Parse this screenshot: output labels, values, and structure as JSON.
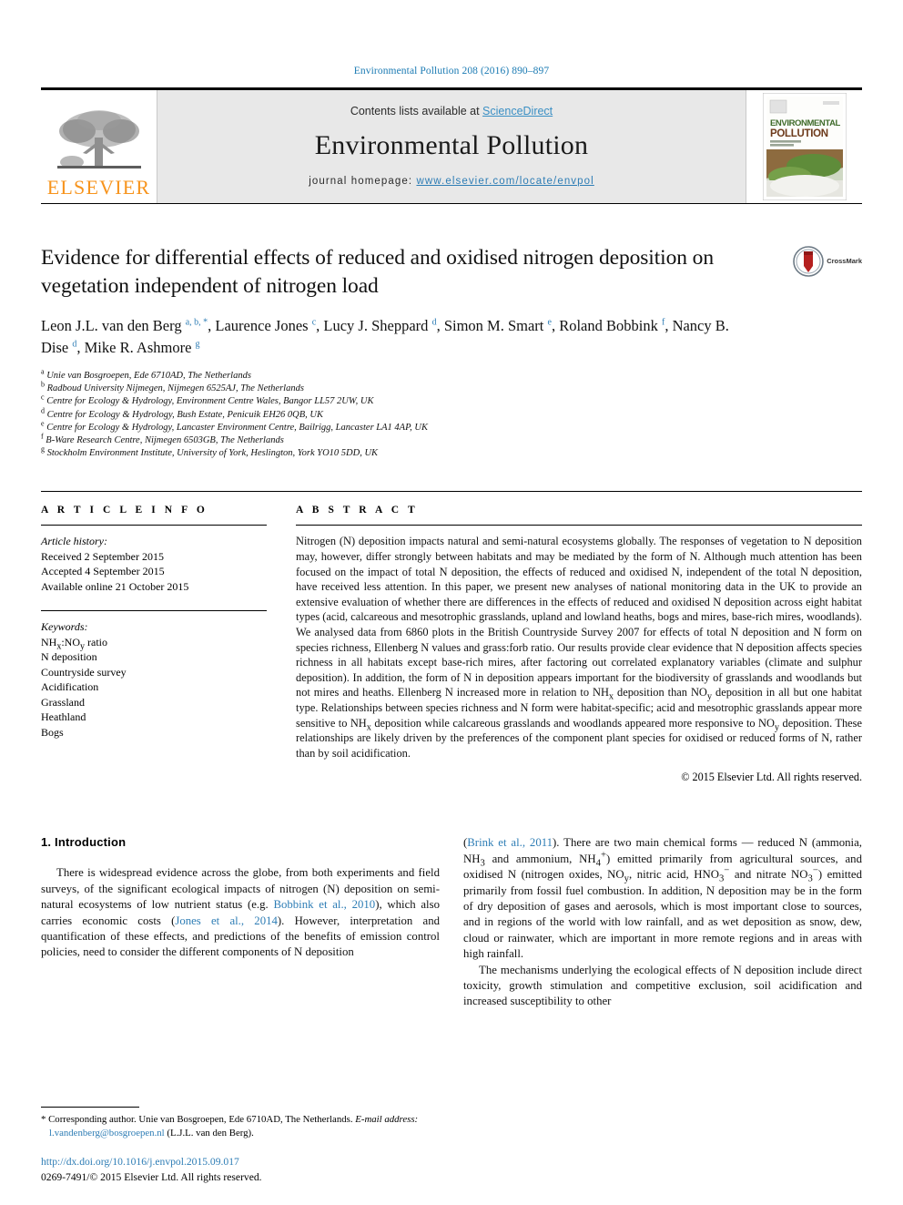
{
  "running_head": "Environmental Pollution 208 (2016) 890–897",
  "masthead": {
    "contents_prefix": "Contents lists available at ",
    "sciencedirect": "ScienceDirect",
    "journal_title": "Environmental Pollution",
    "homepage_label": "journal homepage:",
    "homepage_url": "www.elsevier.com/locate/envpol",
    "publisher": "ELSEVIER",
    "cover_line1": "ENVIRONMENTAL",
    "cover_line2": "POLLUTION"
  },
  "crossmark": {
    "label": "CrossMark"
  },
  "article": {
    "title": "Evidence for differential effects of reduced and oxidised nitrogen deposition on vegetation independent of nitrogen load",
    "authors_html": "Leon J.L. van den Berg <sup>a, b, *</sup>, Laurence Jones <sup>c</sup>, Lucy J. Sheppard <sup>d</sup>, Simon M. Smart <sup>e</sup>, Roland Bobbink <sup>f</sup>, Nancy B. Dise <sup>d</sup>, Mike R. Ashmore <sup>g</sup>",
    "affiliations": [
      {
        "mark": "a",
        "text": "Unie van Bosgroepen, Ede 6710AD, The Netherlands"
      },
      {
        "mark": "b",
        "text": "Radboud University Nijmegen, Nijmegen 6525AJ, The Netherlands"
      },
      {
        "mark": "c",
        "text": "Centre for Ecology & Hydrology, Environment Centre Wales, Bangor LL57 2UW, UK"
      },
      {
        "mark": "d",
        "text": "Centre for Ecology & Hydrology, Bush Estate, Penicuik EH26 0QB, UK"
      },
      {
        "mark": "e",
        "text": "Centre for Ecology & Hydrology, Lancaster Environment Centre, Bailrigg, Lancaster LA1 4AP, UK"
      },
      {
        "mark": "f",
        "text": "B-Ware Research Centre, Nijmegen 6503GB, The Netherlands"
      },
      {
        "mark": "g",
        "text": "Stockholm Environment Institute, University of York, Heslington, York YO10 5DD, UK"
      }
    ]
  },
  "article_info": {
    "heading": "A R T I C L E  I N F O",
    "history_label": "Article history:",
    "history": [
      "Received 2 September 2015",
      "Accepted 4 September 2015",
      "Available online 21 October 2015"
    ],
    "keywords_label": "Keywords:",
    "keywords_html": [
      "NH<sub>x</sub>:NO<sub>y</sub> ratio",
      "N deposition",
      "Countryside survey",
      "Acidification",
      "Grassland",
      "Heathland",
      "Bogs"
    ]
  },
  "abstract": {
    "heading": "A B S T R A C T",
    "text_html": "Nitrogen (N) deposition impacts natural and semi-natural ecosystems globally. The responses of vegetation to N deposition may, however, differ strongly between habitats and may be mediated by the form of N. Although much attention has been focused on the impact of total N deposition, the effects of reduced and oxidised N, independent of the total N deposition, have received less attention. In this paper, we present new analyses of national monitoring data in the UK to provide an extensive evaluation of whether there are differences in the effects of reduced and oxidised N deposition across eight habitat types (acid, calcareous and mesotrophic grasslands, upland and lowland heaths, bogs and mires, base-rich mires, woodlands). We analysed data from 6860 plots in the British Countryside Survey 2007 for effects of total N deposition and N form on species richness, Ellenberg N values and grass:forb ratio. Our results provide clear evidence that N deposition affects species richness in all habitats except base-rich mires, after factoring out correlated explanatory variables (climate and sulphur deposition). In addition, the form of N in deposition appears important for the biodiversity of grasslands and woodlands but not mires and heaths. Ellenberg N increased more in relation to NH<sub>x</sub> deposition than NO<sub>y</sub> deposition in all but one habitat type. Relationships between species richness and N form were habitat-specific; acid and mesotrophic grasslands appear more sensitive to NH<sub>x</sub> deposition while calcareous grasslands and woodlands appeared more responsive to NO<sub>y</sub> deposition. These relationships are likely driven by the preferences of the component plant species for oxidised or reduced forms of N, rather than by soil acidification.",
    "copyright": "© 2015 Elsevier Ltd. All rights reserved."
  },
  "introduction": {
    "heading": "1.  Introduction",
    "left_paragraph_html": "There is widespread evidence across the globe, from both experiments and field surveys, of the significant ecological impacts of nitrogen (N) deposition on semi-natural ecosystems of low nutrient status (e.g. <a class=\"ref\" href=\"#\" data-name=\"citation-link\" data-interactable=\"true\">Bobbink et al., 2010</a>), which also carries economic costs (<a class=\"ref\" href=\"#\" data-name=\"citation-link\" data-interactable=\"true\">Jones et al., 2014</a>). However, interpretation and quantification of these effects, and predictions of the benefits of emission control policies, need to consider the different components of N deposition",
    "right_paragraph_1_html": "(<a class=\"ref\" href=\"#\" data-name=\"citation-link\" data-interactable=\"true\">Brink et al., 2011</a>). There are two main chemical forms &mdash; reduced N (ammonia, NH<sub>3</sub> and ammonium, NH<sub>4</sub><sup>+</sup>) emitted primarily from agricultural sources, and oxidised N (nitrogen oxides, NO<sub>y</sub>, nitric acid, HNO<sub>3</sub><sup>&minus;</sup> and nitrate NO<sub>3</sub><sup>&minus;</sup>) emitted primarily from fossil fuel combustion. In addition, N deposition may be in the form of dry deposition of gases and aerosols, which is most important close to sources, and in regions of the world with low rainfall, and as wet deposition as snow, dew, cloud or rainwater, which are important in more remote regions and in areas with high rainfall.",
    "right_paragraph_2_html": "The mechanisms underlying the ecological effects of N deposition include direct toxicity, growth stimulation and competitive exclusion, soil acidification and increased susceptibility to other"
  },
  "footnote": {
    "star": "*",
    "corresponding_html": "Corresponding author. Unie van Bosgroepen, Ede 6710AD, The Netherlands.",
    "email_label": "E-mail address:",
    "email": "l.vandenberg@bosgroepen.nl",
    "email_owner": "(L.J.L. van den Berg)."
  },
  "page_footer": {
    "doi": "http://dx.doi.org/10.1016/j.envpol.2015.09.017",
    "issn_line": "0269-7491/© 2015 Elsevier Ltd. All rights reserved."
  },
  "colors": {
    "link_blue": "#2e7db5",
    "elsevier_orange": "#f7941d",
    "masthead_grey": "#e8e8e8",
    "crossmark_red": "#b5201f"
  }
}
